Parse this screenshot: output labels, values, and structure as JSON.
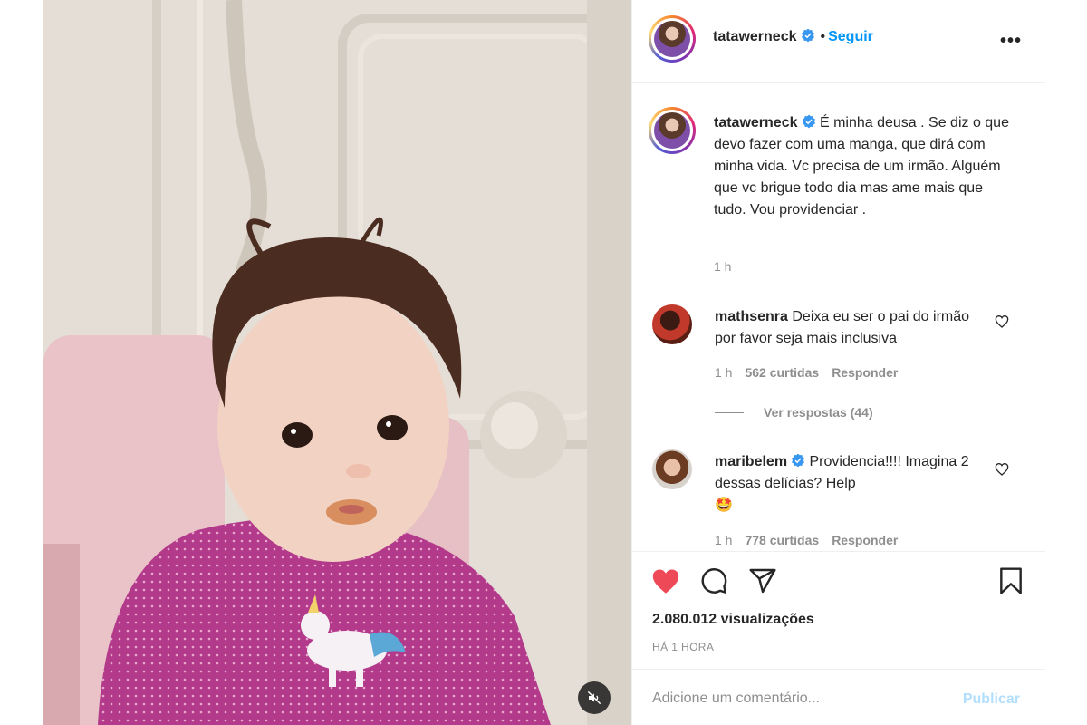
{
  "post": {
    "author": "tatawerneck",
    "follow_label": "Seguir",
    "separator": "•",
    "more_label": "•••"
  },
  "caption": {
    "username": "tatawerneck",
    "text": "É minha deusa . Se diz o que devo fazer com uma manga, que dirá com minha vida. Vc precisa de um irmão. Alguém que vc brigue todo dia mas ame mais que tudo. Vou providenciar .",
    "time": "1 h"
  },
  "comments": [
    {
      "username": "mathsenra",
      "text": "Deixa eu ser o pai do irmão por favor seja mais inclusiva",
      "time": "1 h",
      "likes": "562 curtidas",
      "reply": "Responder"
    },
    {
      "username": "maribelem",
      "text": "Providencia!!!! Imagina 2 dessas delícias? Help",
      "emoji": "🤩",
      "time": "1 h",
      "likes": "778 curtidas",
      "reply": "Responder"
    }
  ],
  "view_replies": "Ver respostas (44)",
  "stats": {
    "views": "2.080.012 visualizações",
    "time_ago": "HÁ 1 HORA"
  },
  "composer": {
    "placeholder": "Adicione um comentário...",
    "publish_label": "Publicar"
  },
  "colors": {
    "like_active": "#ed4956",
    "link_blue": "#0095f6",
    "verified_blue": "#3897f0",
    "publish_disabled": "#b2dffc"
  },
  "icons": [
    "heart-filled-icon",
    "comment-icon",
    "share-icon",
    "bookmark-icon",
    "mute-icon",
    "verified-icon",
    "heart-outline-icon",
    "more-icon"
  ]
}
